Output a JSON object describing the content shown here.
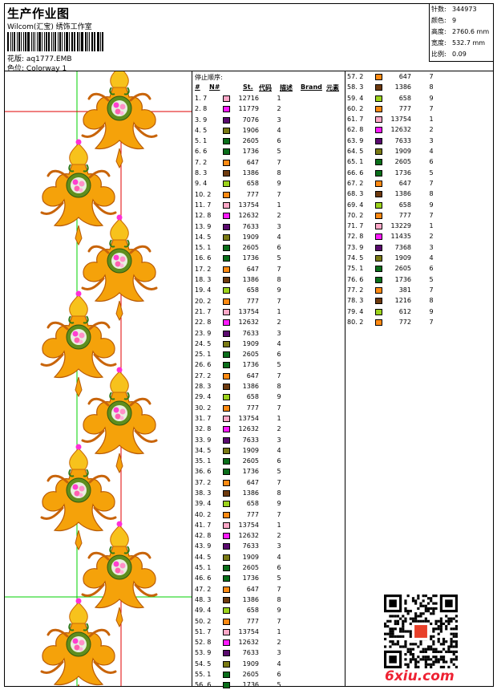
{
  "header": {
    "title": "生产作业图",
    "company": "Wilcom(汇宝) 绣饰工作室",
    "design_label": "花版:",
    "design_value": "aq1777.EMB",
    "colorway_label": "色位:",
    "colorway_value": "Colorway 1"
  },
  "stats": [
    {
      "label": "针数:",
      "value": "344973"
    },
    {
      "label": "颜色:",
      "value": "9"
    },
    {
      "label": "高度:",
      "value": "2760.6 mm"
    },
    {
      "label": "宽度:",
      "value": "532.7 mm"
    },
    {
      "label": "比例:",
      "value": "0.09"
    }
  ],
  "sequence": {
    "heading": "停止顺序:",
    "columns": [
      "#",
      "N#",
      "St.",
      "代码",
      "描述",
      "Brand",
      "元素"
    ]
  },
  "palette": {
    "1": "#0a6e1a",
    "2": "#ff8a12",
    "3": "#6e3a0e",
    "4": "#9cd31c",
    "5": "#7a7a14",
    "6": "#0a6e1a",
    "7": "#ffa8c8",
    "8": "#ff1aff",
    "9": "#5a0a6e"
  },
  "stops": [
    {
      "n": "1.",
      "c": "7",
      "st": "12716",
      "code": "1"
    },
    {
      "n": "2.",
      "c": "8",
      "st": "11779",
      "code": "2"
    },
    {
      "n": "3.",
      "c": "9",
      "st": "7076",
      "code": "3"
    },
    {
      "n": "4.",
      "c": "5",
      "st": "1906",
      "code": "4"
    },
    {
      "n": "5.",
      "c": "1",
      "st": "2605",
      "code": "6"
    },
    {
      "n": "6.",
      "c": "6",
      "st": "1736",
      "code": "5"
    },
    {
      "n": "7.",
      "c": "2",
      "st": "647",
      "code": "7"
    },
    {
      "n": "8.",
      "c": "3",
      "st": "1386",
      "code": "8"
    },
    {
      "n": "9.",
      "c": "4",
      "st": "658",
      "code": "9"
    },
    {
      "n": "10.",
      "c": "2",
      "st": "777",
      "code": "7"
    },
    {
      "n": "11.",
      "c": "7",
      "st": "13754",
      "code": "1"
    },
    {
      "n": "12.",
      "c": "8",
      "st": "12632",
      "code": "2"
    },
    {
      "n": "13.",
      "c": "9",
      "st": "7633",
      "code": "3"
    },
    {
      "n": "14.",
      "c": "5",
      "st": "1909",
      "code": "4"
    },
    {
      "n": "15.",
      "c": "1",
      "st": "2605",
      "code": "6"
    },
    {
      "n": "16.",
      "c": "6",
      "st": "1736",
      "code": "5"
    },
    {
      "n": "17.",
      "c": "2",
      "st": "647",
      "code": "7"
    },
    {
      "n": "18.",
      "c": "3",
      "st": "1386",
      "code": "8"
    },
    {
      "n": "19.",
      "c": "4",
      "st": "658",
      "code": "9"
    },
    {
      "n": "20.",
      "c": "2",
      "st": "777",
      "code": "7"
    },
    {
      "n": "21.",
      "c": "7",
      "st": "13754",
      "code": "1"
    },
    {
      "n": "22.",
      "c": "8",
      "st": "12632",
      "code": "2"
    },
    {
      "n": "23.",
      "c": "9",
      "st": "7633",
      "code": "3"
    },
    {
      "n": "24.",
      "c": "5",
      "st": "1909",
      "code": "4"
    },
    {
      "n": "25.",
      "c": "1",
      "st": "2605",
      "code": "6"
    },
    {
      "n": "26.",
      "c": "6",
      "st": "1736",
      "code": "5"
    },
    {
      "n": "27.",
      "c": "2",
      "st": "647",
      "code": "7"
    },
    {
      "n": "28.",
      "c": "3",
      "st": "1386",
      "code": "8"
    },
    {
      "n": "29.",
      "c": "4",
      "st": "658",
      "code": "9"
    },
    {
      "n": "30.",
      "c": "2",
      "st": "777",
      "code": "7"
    },
    {
      "n": "31.",
      "c": "7",
      "st": "13754",
      "code": "1"
    },
    {
      "n": "32.",
      "c": "8",
      "st": "12632",
      "code": "2"
    },
    {
      "n": "33.",
      "c": "9",
      "st": "7633",
      "code": "3"
    },
    {
      "n": "34.",
      "c": "5",
      "st": "1909",
      "code": "4"
    },
    {
      "n": "35.",
      "c": "1",
      "st": "2605",
      "code": "6"
    },
    {
      "n": "36.",
      "c": "6",
      "st": "1736",
      "code": "5"
    },
    {
      "n": "37.",
      "c": "2",
      "st": "647",
      "code": "7"
    },
    {
      "n": "38.",
      "c": "3",
      "st": "1386",
      "code": "8"
    },
    {
      "n": "39.",
      "c": "4",
      "st": "658",
      "code": "9"
    },
    {
      "n": "40.",
      "c": "2",
      "st": "777",
      "code": "7"
    },
    {
      "n": "41.",
      "c": "7",
      "st": "13754",
      "code": "1"
    },
    {
      "n": "42.",
      "c": "8",
      "st": "12632",
      "code": "2"
    },
    {
      "n": "43.",
      "c": "9",
      "st": "7633",
      "code": "3"
    },
    {
      "n": "44.",
      "c": "5",
      "st": "1909",
      "code": "4"
    },
    {
      "n": "45.",
      "c": "1",
      "st": "2605",
      "code": "6"
    },
    {
      "n": "46.",
      "c": "6",
      "st": "1736",
      "code": "5"
    },
    {
      "n": "47.",
      "c": "2",
      "st": "647",
      "code": "7"
    },
    {
      "n": "48.",
      "c": "3",
      "st": "1386",
      "code": "8"
    },
    {
      "n": "49.",
      "c": "4",
      "st": "658",
      "code": "9"
    },
    {
      "n": "50.",
      "c": "2",
      "st": "777",
      "code": "7"
    },
    {
      "n": "51.",
      "c": "7",
      "st": "13754",
      "code": "1"
    },
    {
      "n": "52.",
      "c": "8",
      "st": "12632",
      "code": "2"
    },
    {
      "n": "53.",
      "c": "9",
      "st": "7633",
      "code": "3"
    },
    {
      "n": "54.",
      "c": "5",
      "st": "1909",
      "code": "4"
    },
    {
      "n": "55.",
      "c": "1",
      "st": "2605",
      "code": "6"
    },
    {
      "n": "56.",
      "c": "6",
      "st": "1736",
      "code": "5"
    },
    {
      "n": "57.",
      "c": "2",
      "st": "647",
      "code": "7"
    },
    {
      "n": "58.",
      "c": "3",
      "st": "1386",
      "code": "8"
    },
    {
      "n": "59.",
      "c": "4",
      "st": "658",
      "code": "9"
    },
    {
      "n": "60.",
      "c": "2",
      "st": "777",
      "code": "7"
    },
    {
      "n": "61.",
      "c": "7",
      "st": "13754",
      "code": "1"
    },
    {
      "n": "62.",
      "c": "8",
      "st": "12632",
      "code": "2"
    },
    {
      "n": "63.",
      "c": "9",
      "st": "7633",
      "code": "3"
    },
    {
      "n": "64.",
      "c": "5",
      "st": "1909",
      "code": "4"
    },
    {
      "n": "65.",
      "c": "1",
      "st": "2605",
      "code": "6"
    },
    {
      "n": "66.",
      "c": "6",
      "st": "1736",
      "code": "5"
    },
    {
      "n": "67.",
      "c": "2",
      "st": "647",
      "code": "7"
    },
    {
      "n": "68.",
      "c": "3",
      "st": "1386",
      "code": "8"
    },
    {
      "n": "69.",
      "c": "4",
      "st": "658",
      "code": "9"
    },
    {
      "n": "70.",
      "c": "2",
      "st": "777",
      "code": "7"
    },
    {
      "n": "71.",
      "c": "7",
      "st": "13229",
      "code": "1"
    },
    {
      "n": "72.",
      "c": "8",
      "st": "11435",
      "code": "2"
    },
    {
      "n": "73.",
      "c": "9",
      "st": "7368",
      "code": "3"
    },
    {
      "n": "74.",
      "c": "5",
      "st": "1909",
      "code": "4"
    },
    {
      "n": "75.",
      "c": "1",
      "st": "2605",
      "code": "6"
    },
    {
      "n": "76.",
      "c": "6",
      "st": "1736",
      "code": "5"
    },
    {
      "n": "77.",
      "c": "2",
      "st": "381",
      "code": "7"
    },
    {
      "n": "78.",
      "c": "3",
      "st": "1216",
      "code": "8"
    },
    {
      "n": "79.",
      "c": "4",
      "st": "612",
      "code": "9"
    },
    {
      "n": "80.",
      "c": "2",
      "st": "772",
      "code": "7"
    }
  ],
  "watermark": "6xiu.com"
}
